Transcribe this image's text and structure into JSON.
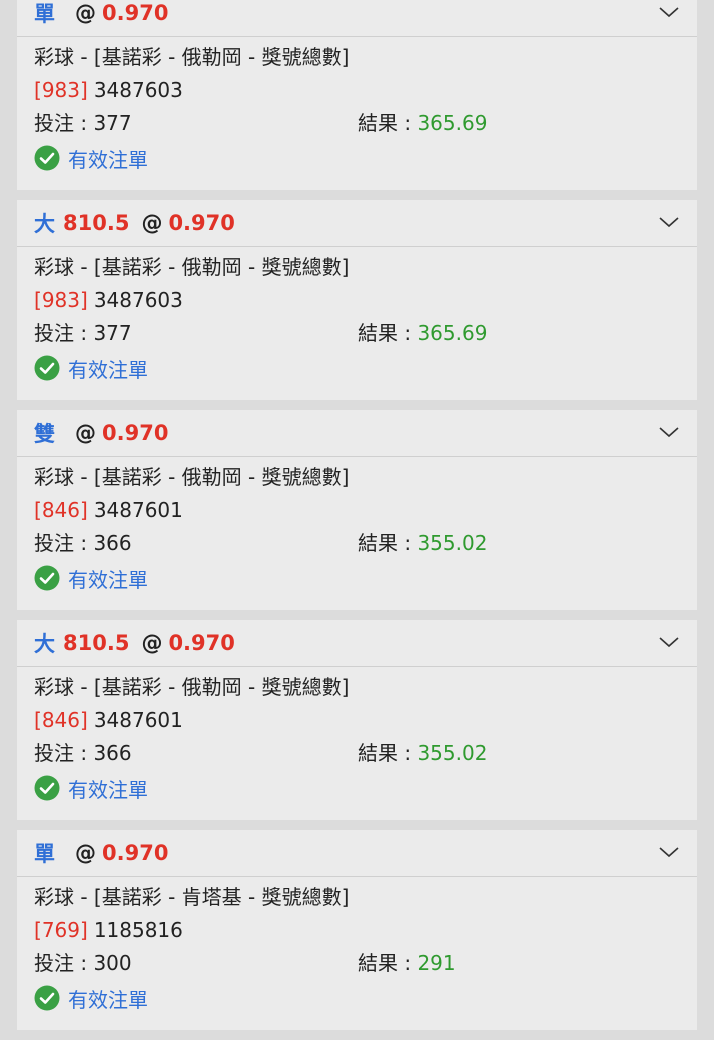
{
  "labels": {
    "market": "彩球",
    "stake": "投注",
    "result": "結果",
    "valid": "有效注單",
    "at": "@"
  },
  "cards": [
    {
      "pick": "單",
      "line": "",
      "odds": "0.970",
      "game": "基諾彩",
      "region": "俄勒岡",
      "bet_type": "獎號總數",
      "code": "983",
      "draw": "3487603",
      "stake": "377",
      "result": "365.69"
    },
    {
      "pick": "大",
      "line": "810.5",
      "odds": "0.970",
      "game": "基諾彩",
      "region": "俄勒岡",
      "bet_type": "獎號總數",
      "code": "983",
      "draw": "3487603",
      "stake": "377",
      "result": "365.69"
    },
    {
      "pick": "雙",
      "line": "",
      "odds": "0.970",
      "game": "基諾彩",
      "region": "俄勒岡",
      "bet_type": "獎號總數",
      "code": "846",
      "draw": "3487601",
      "stake": "366",
      "result": "355.02"
    },
    {
      "pick": "大",
      "line": "810.5",
      "odds": "0.970",
      "game": "基諾彩",
      "region": "俄勒岡",
      "bet_type": "獎號總數",
      "code": "846",
      "draw": "3487601",
      "stake": "366",
      "result": "355.02"
    },
    {
      "pick": "單",
      "line": "",
      "odds": "0.970",
      "game": "基諾彩",
      "region": "肯塔基",
      "bet_type": "獎號總數",
      "code": "769",
      "draw": "1185816",
      "stake": "300",
      "result": "291"
    }
  ]
}
